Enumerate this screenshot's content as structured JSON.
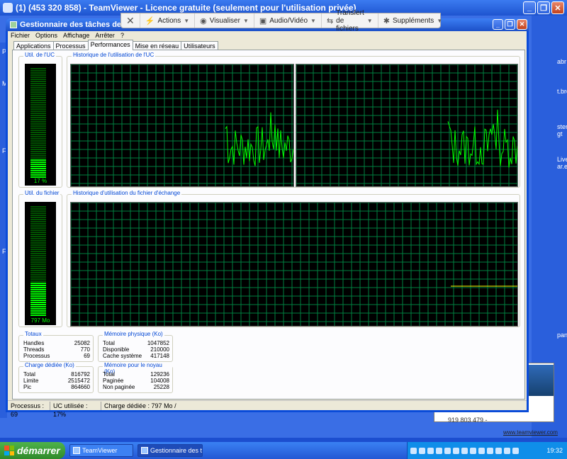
{
  "teamviewer": {
    "title": "(1) (453 320 858) - TeamViewer - Licence gratuite (seulement pour l'utilisation privée)",
    "toolbar": [
      {
        "label": "Actions",
        "icon": "lightning-icon"
      },
      {
        "label": "Visualiser",
        "icon": "eye-icon"
      },
      {
        "label": "Audio/Vidéo",
        "icon": "audio-video-icon"
      },
      {
        "label": "Transfert de fichiers",
        "icon": "file-transfer-icon"
      },
      {
        "label": "Suppléments",
        "icon": "gear-icon"
      }
    ],
    "remote_id": "919 803 479 -",
    "remote_link": "www.teamviewer.com"
  },
  "taskmanager": {
    "title": "Gestionnaire des tâches de Windows",
    "menu": [
      "Fichier",
      "Options",
      "Affichage",
      "Arrêter",
      "?"
    ],
    "tabs": [
      "Applications",
      "Processus",
      "Performances",
      "Mise en réseau",
      "Utilisateurs"
    ],
    "active_tab": "Performances",
    "cpu_meter": {
      "title": "Util. de l'UC",
      "label": "17 %",
      "value_percent": 17
    },
    "cpu_history": {
      "title": "Historique de l'utilisation de l'UC"
    },
    "pf_meter": {
      "title": "Util. du fichier",
      "label": "797 Mo",
      "value_fraction": 0.31
    },
    "pf_history": {
      "title": "Historique d'utilisation du fichier d'échange"
    },
    "totaux": {
      "title": "Totaux",
      "rows": [
        [
          "Handles",
          "25082"
        ],
        [
          "Threads",
          "770"
        ],
        [
          "Processus",
          "69"
        ]
      ]
    },
    "physical": {
      "title": "Mémoire physique (Ko)",
      "rows": [
        [
          "Total",
          "1047852"
        ],
        [
          "Disponible",
          "210000"
        ],
        [
          "Cache système",
          "417148"
        ]
      ]
    },
    "commit": {
      "title": "Charge dédiée (Ko)",
      "rows": [
        [
          "Total",
          "816792"
        ],
        [
          "Limite",
          "2515472"
        ],
        [
          "Pic",
          "864660"
        ]
      ]
    },
    "kernel": {
      "title": "Mémoire pour le noyau (Ko)",
      "rows": [
        [
          "Total",
          "129236"
        ],
        [
          "Paginée",
          "104008"
        ],
        [
          "Non paginée",
          "25228"
        ]
      ]
    },
    "status": {
      "processes": "Processus : 69",
      "cpu": "UC utilisée : 17%",
      "commit": "Charge dédiée : 797 Mo /"
    }
  },
  "taskbar": {
    "start": "démarrer",
    "buttons": [
      {
        "label": "TeamViewer"
      },
      {
        "label": "Gestionnaire des tâch..."
      }
    ],
    "clock": "19:32"
  },
  "desktop_labels": [
    "P",
    "M",
    "F",
    "F",
    "abr",
    "t.bro",
    "ster",
    "gt",
    "Live",
    "ar.exe",
    "pand"
  ]
}
